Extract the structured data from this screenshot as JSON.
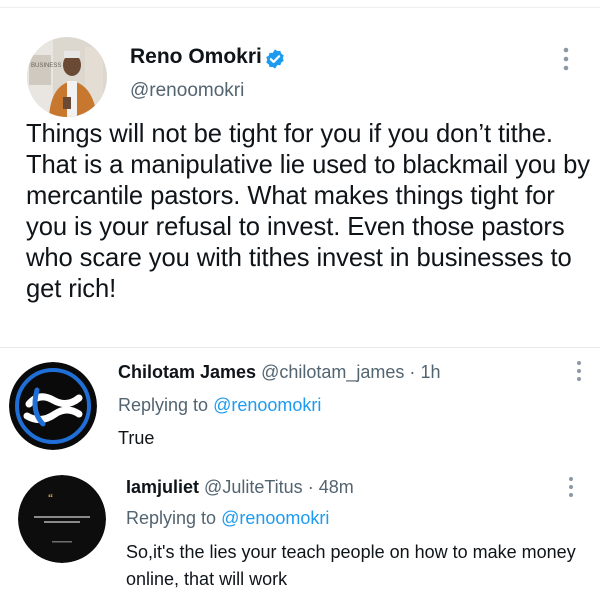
{
  "main_tweet": {
    "name": "Reno Omokri",
    "verified_icon": "verified-badge-icon",
    "handle": "@renoomokri",
    "text": "Things will not be tight for you if you don’t tithe. That is a manipulative lie used to blackmail you by mercantile pastors. What makes things tight for you is your refusal to invest. Even those pastors who scare you with tithes invest in businesses to get rich!",
    "avatar_sign": "BUSINESS"
  },
  "replies": [
    {
      "name": "Chilotam James",
      "handle": "@chilotam_james",
      "separator": "·",
      "time": "1h",
      "replying_prefix": "Replying to",
      "replying_to": "@renoomokri",
      "text": "True"
    },
    {
      "name": "Iamjuliet",
      "handle": "@JuliteTitus",
      "separator": "·",
      "time": "48m",
      "replying_prefix": "Replying to",
      "replying_to": "@renoomokri",
      "text": "So,it's the lies your teach people on how to make money online, that will work",
      "avatar_text": "A life not lived for others is not a life."
    }
  ],
  "colors": {
    "text": "#0f1419",
    "muted": "#536471",
    "link": "#1d9bf0",
    "divider": "#e6e9eb"
  }
}
